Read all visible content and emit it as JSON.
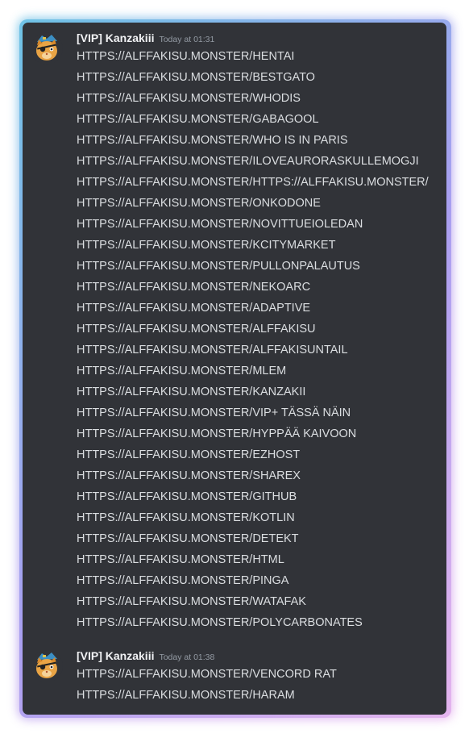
{
  "messages": [
    {
      "author": "[VIP] Kanzakiii",
      "timestamp": "Today at 01:31",
      "avatar_icon": "orange-cat-pirate-avatar-icon",
      "lines": [
        "HTTPS://ALFFAKISU.MONSTER/HENTAI",
        "HTTPS://ALFFAKISU.MONSTER/BESTGATO",
        "HTTPS://ALFFAKISU.MONSTER/WHODIS",
        "HTTPS://ALFFAKISU.MONSTER/GABAGOOL",
        "HTTPS://ALFFAKISU.MONSTER/WHO IS IN PARIS",
        "HTTPS://ALFFAKISU.MONSTER/ILOVEAURORASKULLEMOGJI",
        "HTTPS://ALFFAKISU.MONSTER/HTTPS://ALFFAKISU.MONSTER/",
        "HTTPS://ALFFAKISU.MONSTER/ONKODONE",
        "HTTPS://ALFFAKISU.MONSTER/NOVITTUEIOLEDAN",
        "HTTPS://ALFFAKISU.MONSTER/KCITYMARKET",
        "HTTPS://ALFFAKISU.MONSTER/PULLONPALAUTUS",
        "HTTPS://ALFFAKISU.MONSTER/NEKOARC",
        "HTTPS://ALFFAKISU.MONSTER/ADAPTIVE",
        "HTTPS://ALFFAKISU.MONSTER/ALFFAKISU",
        "HTTPS://ALFFAKISU.MONSTER/ALFFAKISUNTAIL",
        "HTTPS://ALFFAKISU.MONSTER/MLEM",
        "HTTPS://ALFFAKISU.MONSTER/KANZAKII",
        "HTTPS://ALFFAKISU.MONSTER/VIP+ TÄSSÄ NÄIN",
        "HTTPS://ALFFAKISU.MONSTER/HYPPÄÄ KAIVOON",
        "HTTPS://ALFFAKISU.MONSTER/EZHOST",
        "HTTPS://ALFFAKISU.MONSTER/SHAREX",
        "HTTPS://ALFFAKISU.MONSTER/GITHUB",
        "HTTPS://ALFFAKISU.MONSTER/KOTLIN",
        "HTTPS://ALFFAKISU.MONSTER/DETEKT",
        "HTTPS://ALFFAKISU.MONSTER/HTML",
        "HTTPS://ALFFAKISU.MONSTER/PINGA",
        "HTTPS://ALFFAKISU.MONSTER/WATAFAK",
        "HTTPS://ALFFAKISU.MONSTER/POLYCARBONATES"
      ]
    },
    {
      "author": "[VIP] Kanzakiii",
      "timestamp": "Today at 01:38",
      "avatar_icon": "orange-cat-pirate-avatar-icon",
      "lines": [
        "HTTPS://ALFFAKISU.MONSTER/VENCORD RAT",
        "HTTPS://ALFFAKISU.MONSTER/HARAM"
      ]
    }
  ],
  "colors": {
    "panel_bg": "#313338",
    "username": "#f2f3f5",
    "timestamp": "#949ba4",
    "message_text": "#dbdee1",
    "border_gradient_start": "#6fc3e6",
    "border_gradient_end": "#e4b4ee"
  }
}
